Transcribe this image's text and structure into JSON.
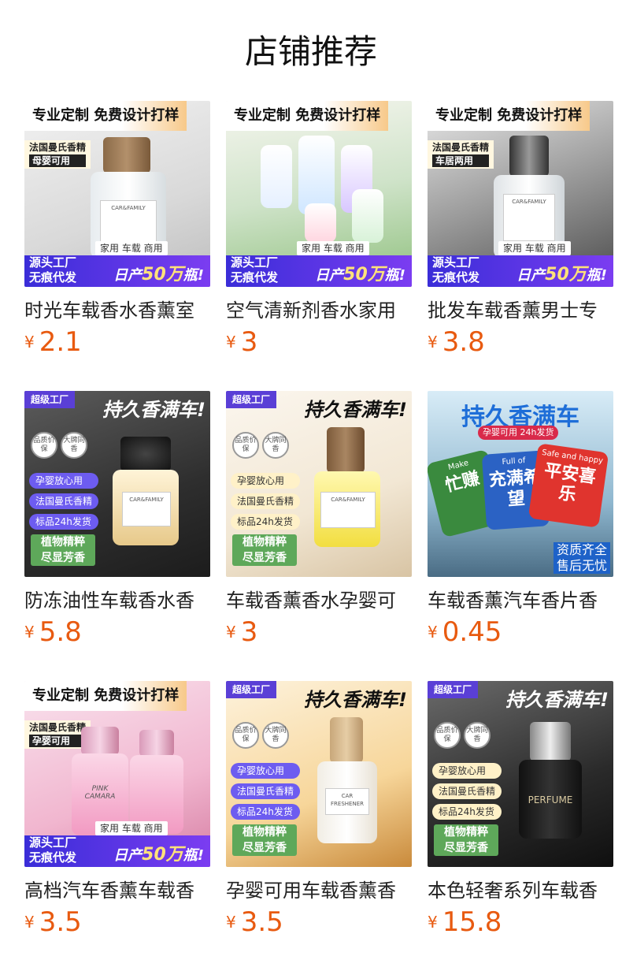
{
  "page": {
    "title": "店铺推荐"
  },
  "colors": {
    "price": "#e85a10",
    "title": "#111111",
    "text": "#222222"
  },
  "products": [
    {
      "name": "时光车载香水香薰室",
      "currency": "¥",
      "price": "2.1",
      "image": {
        "banner": "专业定制 免费设计打样",
        "side": [
          "法国曼氏香精",
          "母婴可用"
        ],
        "factory": [
          "源头工厂",
          "无痕代发"
        ],
        "tags": "家用 车载 商用",
        "daily_prefix": "日产",
        "daily_value": "50万",
        "daily_suffix": "瓶!",
        "bottle_brand": "CAR&FAMILY"
      }
    },
    {
      "name": "空气清新剂香水家用",
      "currency": "¥",
      "price": "3",
      "image": {
        "banner": "专业定制 免费设计打样",
        "factory": [
          "源头工厂",
          "无痕代发"
        ],
        "tags": "家用 车载 商用",
        "daily_prefix": "日产",
        "daily_value": "50万",
        "daily_suffix": "瓶!"
      }
    },
    {
      "name": "批发车载香薰男士专",
      "currency": "¥",
      "price": "3.8",
      "image": {
        "banner": "专业定制 免费设计打样",
        "side": [
          "法国曼氏香精",
          "车居两用"
        ],
        "factory": [
          "源头工厂",
          "无痕代发"
        ],
        "tags": "家用 车载 商用",
        "daily_prefix": "日产",
        "daily_value": "50万",
        "daily_suffix": "瓶!",
        "bottle_brand": "CAR&FAMILY"
      }
    },
    {
      "name": "防冻油性车载香水香",
      "currency": "¥",
      "price": "5.8",
      "image": {
        "super": "超级工厂",
        "headline": "持久香满车!",
        "badges": [
          "品质价保",
          "大牌同香"
        ],
        "bullets": [
          "孕婴放心用",
          "法国曼氏香精",
          "标品24h发货"
        ],
        "green": [
          "植物精粹",
          "尽显芳香"
        ],
        "bottle_brand": "CAR&FAMILY"
      }
    },
    {
      "name": "车载香薰香水孕婴可",
      "currency": "¥",
      "price": "3",
      "image": {
        "super": "超级工厂",
        "headline": "持久香满车!",
        "badges": [
          "品质价保",
          "大牌同香"
        ],
        "bullets": [
          "孕婴放心用",
          "法国曼氏香精",
          "标品24h发货"
        ],
        "green": [
          "植物精粹",
          "尽显芳香"
        ],
        "bottle_brand": "CAR&FAMILY"
      }
    },
    {
      "name": "车载香薰汽车香片香",
      "currency": "¥",
      "price": "0.45",
      "image": {
        "headline": "持久香满车",
        "pill": "孕婴可用 24h发货",
        "cards": [
          "忙赚",
          "充满希望",
          "平安喜乐"
        ],
        "card_captions": [
          "Make",
          "Full of",
          "Safe and happy"
        ],
        "promise": [
          "资质齐全",
          "售后无忧"
        ]
      }
    },
    {
      "name": "高档汽车香薰车载香",
      "currency": "¥",
      "price": "3.5",
      "image": {
        "banner": "专业定制 免费设计打样",
        "side": [
          "法国曼氏香精",
          "孕婴可用"
        ],
        "factory": [
          "源头工厂",
          "无痕代发"
        ],
        "tags": "家用 车载 商用",
        "daily_prefix": "日产",
        "daily_value": "50万",
        "daily_suffix": "瓶!",
        "bottle_brand": "PINK CAMARA"
      }
    },
    {
      "name": "孕婴可用车载香薰香",
      "currency": "¥",
      "price": "3.5",
      "image": {
        "super": "超级工厂",
        "headline": "持久香满车!",
        "badges": [
          "品质价保",
          "大牌同香"
        ],
        "bullets": [
          "孕婴放心用",
          "法国曼氏香精",
          "标品24h发货"
        ],
        "green": [
          "植物精粹",
          "尽显芳香"
        ],
        "bottle_brand": "CAR FRESHENER"
      }
    },
    {
      "name": "本色轻奢系列车载香",
      "currency": "¥",
      "price": "15.8",
      "image": {
        "super": "超级工厂",
        "headline": "持久香满车!",
        "badges": [
          "品质价保",
          "大牌同香"
        ],
        "bullets": [
          "孕婴放心用",
          "法国曼氏香精",
          "标品24h发货"
        ],
        "green": [
          "植物精粹",
          "尽显芳香"
        ],
        "bottle_brand": "PERFUME"
      }
    }
  ]
}
